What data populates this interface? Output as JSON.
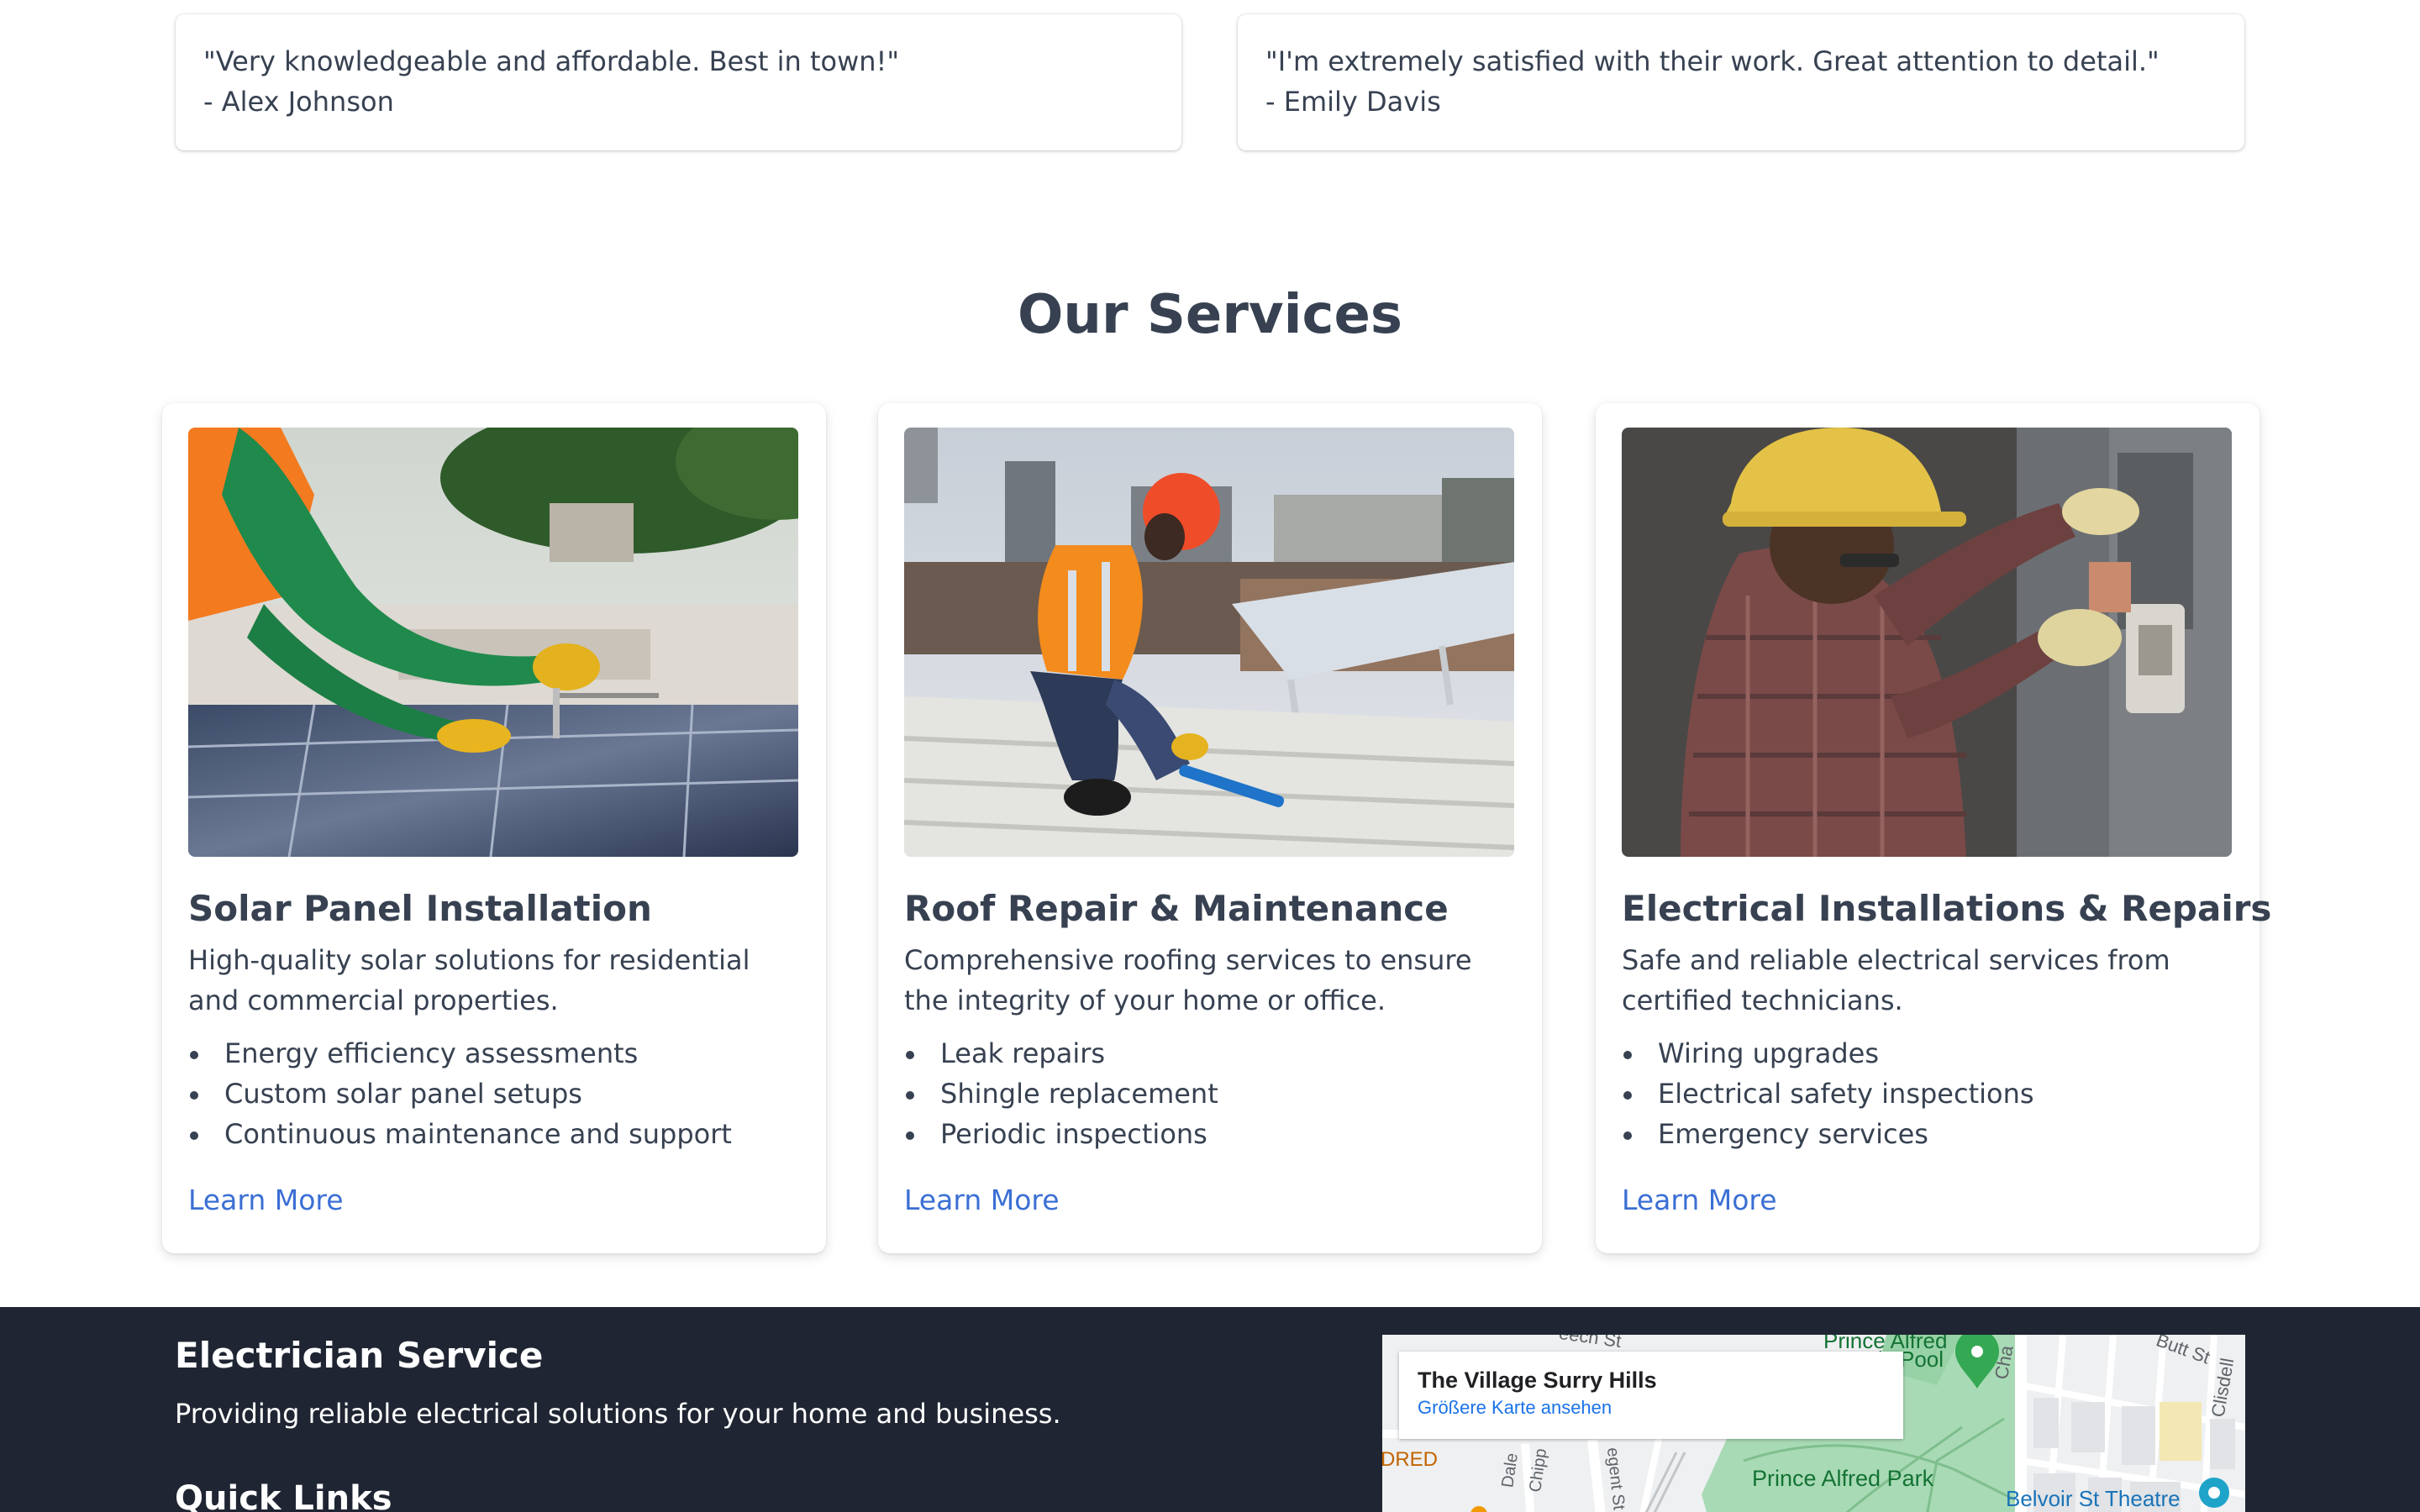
{
  "testimonials": [
    {
      "quote": "\"Very knowledgeable and affordable. Best in town!\"",
      "author": "- Alex Johnson"
    },
    {
      "quote": "\"I'm extremely satisfied with their work. Great attention to detail.\"",
      "author": "- Emily Davis"
    }
  ],
  "services": {
    "title": "Our Services",
    "items": [
      {
        "title": "Solar Panel Installation",
        "description": "High-quality solar solutions for residential and commercial properties.",
        "features": [
          "Energy efficiency assessments",
          "Custom solar panel setups",
          "Continuous maintenance and support"
        ],
        "link": "Learn More",
        "image": "worker-installing-solar-panels-photo"
      },
      {
        "title": "Roof Repair & Maintenance",
        "description": "Comprehensive roofing services to ensure the integrity of your home or office.",
        "features": [
          "Leak repairs",
          "Shingle replacement",
          "Periodic inspections"
        ],
        "link": "Learn More",
        "image": "worker-on-roof-photo"
      },
      {
        "title": "Electrical Installations & Repairs",
        "description": "Safe and reliable electrical services from certified technicians.",
        "features": [
          "Wiring upgrades",
          "Electrical safety inspections",
          "Emergency services"
        ],
        "link": "Learn More",
        "image": "electrician-at-panel-photo"
      }
    ]
  },
  "footer": {
    "brand": "Electrician Service",
    "tagline": "Providing reliable electrical solutions for your home and business.",
    "quick_links_title": "Quick Links",
    "map": {
      "place_name": "The Village Surry Hills",
      "larger_map_link": "Größere Karte ansehen",
      "labels": {
        "prince_alfred_pool": "Prince Alfred",
        "pool_suffix": "ic Pool",
        "butt_st": "Butt St",
        "prince_alfred_park": "Prince Alfred Park",
        "belvoir": "Belvoir St Theatre",
        "red": "DRED",
        "dale": "Dale",
        "chipp": "Chipp",
        "regent": "egent St",
        "cha": "Cha",
        "clisdell": "Clisdell",
        "top_st": "eech St"
      },
      "colors": {
        "park": "#a8dab5",
        "water": "#aadaff",
        "pin": "#34a853",
        "theatre_pin": "#1fa3c9"
      }
    }
  }
}
